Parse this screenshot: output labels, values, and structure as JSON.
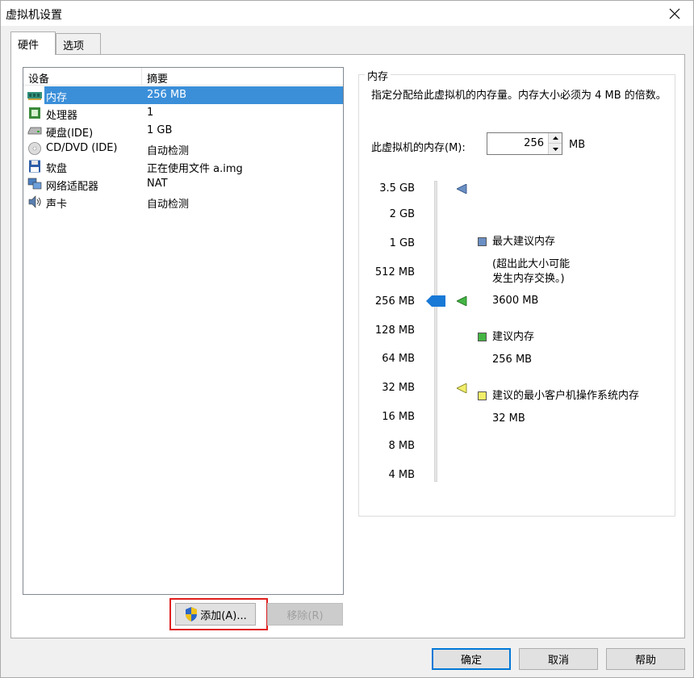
{
  "window": {
    "title": "虚拟机设置"
  },
  "tabs": [
    {
      "label": "硬件"
    },
    {
      "label": "选项"
    }
  ],
  "device_list": {
    "headers": {
      "device": "设备",
      "summary": "摘要"
    },
    "rows": [
      {
        "name": "内存",
        "summary": "256 MB",
        "icon": "memory-icon",
        "selected": true
      },
      {
        "name": "处理器",
        "summary": "1",
        "icon": "processor-icon"
      },
      {
        "name": "硬盘(IDE)",
        "summary": "1 GB",
        "icon": "hard-disk-icon"
      },
      {
        "name": "CD/DVD (IDE)",
        "summary": "自动检测",
        "icon": "cd-dvd-icon"
      },
      {
        "name": "软盘",
        "summary": "正在使用文件 a.img",
        "icon": "floppy-icon"
      },
      {
        "name": "网络适配器",
        "summary": "NAT",
        "icon": "network-adapter-icon"
      },
      {
        "name": "声卡",
        "summary": "自动检测",
        "icon": "sound-card-icon"
      }
    ]
  },
  "buttons": {
    "add": "添加(A)...",
    "remove": "移除(R)",
    "ok": "确定",
    "cancel": "取消",
    "help": "帮助"
  },
  "memory": {
    "group_title": "内存",
    "description": "指定分配给此虚拟机的内存量。内存大小必须为 4 MB 的倍数。",
    "field_label": "此虚拟机的内存(M):",
    "value": "256",
    "unit": "MB",
    "scale": [
      "3.5 GB",
      "2 GB",
      "1 GB",
      "512 MB",
      "256 MB",
      "128 MB",
      "64 MB",
      "32 MB",
      "16 MB",
      "8 MB",
      "4 MB"
    ],
    "legend": {
      "max_title": "最大建议内存",
      "max_note_line1": "(超出此大小可能",
      "max_note_line2": "发生内存交换。)",
      "max_value": "3600 MB",
      "rec_title": "建议内存",
      "rec_value": "256 MB",
      "min_title": "建议的最小客户机操作系统内存",
      "min_value": "32 MB"
    },
    "colors": {
      "max": "#6a8fc4",
      "recommended": "#44b544",
      "minimum": "#f2ee6a",
      "thumb": "#1979d6"
    }
  }
}
